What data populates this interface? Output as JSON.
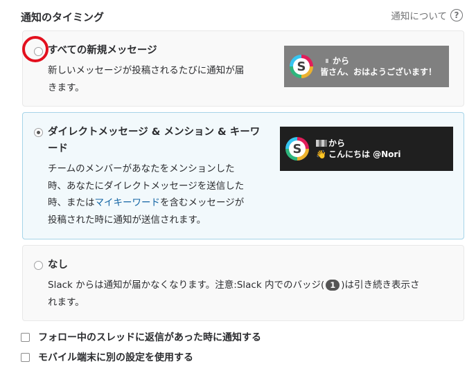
{
  "header": {
    "title": "通知のタイミング",
    "about_label": "通知について",
    "help_icon": "?"
  },
  "options": {
    "all": {
      "title": "すべての新規メッセージ",
      "desc_line1": "新しいメッセージが投稿されるたびに通知が届",
      "desc_line2": "きます。",
      "selected": false,
      "preview": {
        "from_suffix": "から",
        "message": "皆さん、おはようございます！"
      }
    },
    "dm": {
      "title_line1": "ダイレクトメッセージ & メンション & キーワ",
      "title_line2": "ード",
      "desc_line1": "チームのメンバーがあなたをメンションした",
      "desc_line2": "時、あなたにダイレクトメッセージを送信した",
      "desc_line3_before": "時、または",
      "desc_line3_link": "マイキーワード",
      "desc_line3_after": "を含むメッセージが",
      "desc_line4": "投稿された時に通知が送信されます。",
      "selected": true,
      "preview": {
        "from_suffix": "から",
        "wave_emoji": "👋",
        "message": "こんにちは @Nori"
      }
    },
    "none": {
      "title": "なし",
      "desc_line1_before": "Slack からは通知が届かなくなります。注意:Slack 内でのバッジ(",
      "badge": "1",
      "desc_line1_after": ")は引き続き表示さ",
      "desc_line2": "れます。",
      "selected": false
    }
  },
  "checkboxes": {
    "threads": "フォロー中のスレッドに返信があった時に通知する",
    "mobile": "モバイル端末に別の設定を使用する"
  },
  "colors": {
    "selected_bg": "#f2f9fc",
    "selected_border": "#a6d4e8",
    "link": "#1264a3",
    "highlight_circle": "#e3101e"
  }
}
